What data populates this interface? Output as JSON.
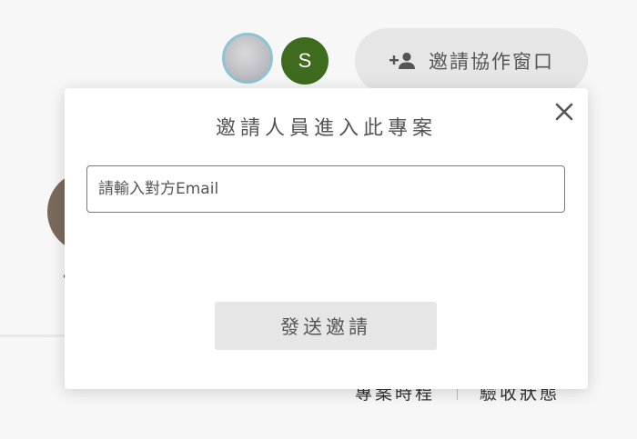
{
  "header": {
    "collaborator_initial": "S",
    "collaborator_initial_color": "#3f6b1f",
    "invite_button_label": "邀請協作窗口",
    "invite_button_icon": "add-person-icon"
  },
  "background": {
    "links": [
      "專案時程",
      "驗收狀態"
    ]
  },
  "dialog": {
    "title": "邀請人員進入此專案",
    "close_icon": "close-icon",
    "email_placeholder": "請輸入對方Email",
    "email_value": "",
    "send_button_label": "發送邀請"
  }
}
